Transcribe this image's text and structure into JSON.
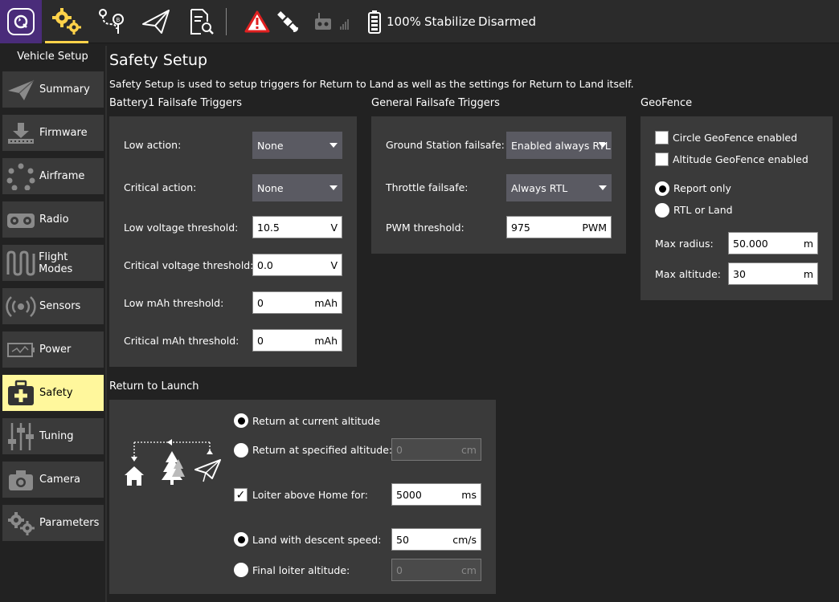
{
  "toolbar": {
    "battery_pct": "100%",
    "flight_mode": "Stabilize",
    "arm_state": "Disarmed"
  },
  "sidebar": {
    "title": "Vehicle Setup",
    "items": [
      {
        "label": "Summary",
        "icon": "paper-plane-icon"
      },
      {
        "label": "Firmware",
        "icon": "download-icon"
      },
      {
        "label": "Airframe",
        "icon": "airframe-icon"
      },
      {
        "label": "Radio",
        "icon": "radio-icon"
      },
      {
        "label": "Flight Modes",
        "icon": "waves-icon"
      },
      {
        "label": "Sensors",
        "icon": "sensors-icon"
      },
      {
        "label": "Power",
        "icon": "power-icon"
      },
      {
        "label": "Safety",
        "icon": "first-aid-icon"
      },
      {
        "label": "Tuning",
        "icon": "sliders-icon"
      },
      {
        "label": "Camera",
        "icon": "camera-icon"
      },
      {
        "label": "Parameters",
        "icon": "gears-icon"
      }
    ]
  },
  "page": {
    "title": "Safety Setup",
    "description": "Safety Setup is used to setup triggers for Return to Land as well as the settings for Return to Land itself."
  },
  "battery": {
    "title": "Battery1 Failsafe Triggers",
    "low_action_label": "Low action:",
    "low_action_value": "None",
    "critical_action_label": "Critical action:",
    "critical_action_value": "None",
    "low_voltage_label": "Low voltage threshold:",
    "low_voltage_value": "10.5",
    "low_voltage_unit": "V",
    "critical_voltage_label": "Critical voltage threshold:",
    "critical_voltage_value": "0.0",
    "critical_voltage_unit": "V",
    "low_mah_label": "Low mAh threshold:",
    "low_mah_value": "0",
    "low_mah_unit": "mAh",
    "critical_mah_label": "Critical mAh threshold:",
    "critical_mah_value": "0",
    "critical_mah_unit": "mAh"
  },
  "general": {
    "title": "General Failsafe Triggers",
    "gcs_label": "Ground Station failsafe:",
    "gcs_value": "Enabled always RTL",
    "throttle_label": "Throttle failsafe:",
    "throttle_value": "Always RTL",
    "pwm_label": "PWM threshold:",
    "pwm_value": "975",
    "pwm_unit": "PWM"
  },
  "geofence": {
    "title": "GeoFence",
    "circle_label": "Circle GeoFence enabled",
    "circle_checked": false,
    "altitude_label": "Altitude GeoFence enabled",
    "altitude_checked": false,
    "report_only_label": "Report only",
    "rtl_or_land_label": "RTL or Land",
    "selected_action": "Report only",
    "max_radius_label": "Max radius:",
    "max_radius_value": "50.000",
    "max_radius_unit": "m",
    "max_alt_label": "Max altitude:",
    "max_alt_value": "30",
    "max_alt_unit": "m"
  },
  "rtl": {
    "title": "Return to Launch",
    "current_alt_label": "Return at current altitude",
    "specified_alt_label": "Return at specified altitude:",
    "specified_alt_value": "0",
    "specified_alt_unit": "cm",
    "selected_return": "Return at current altitude",
    "loiter_label": "Loiter above Home for:",
    "loiter_checked": true,
    "loiter_value": "5000",
    "loiter_unit": "ms",
    "land_descent_label": "Land with descent speed:",
    "land_descent_value": "50",
    "land_descent_unit": "cm/s",
    "final_loiter_label": "Final loiter altitude:",
    "final_loiter_value": "0",
    "final_loiter_unit": "cm",
    "selected_landing": "Land with descent speed:"
  },
  "colors": {
    "active_tab_underline": "#ffd24a",
    "active_sidebar": "#fff79c",
    "logo_bg": "#4a2c7a",
    "warning_red": "#e02020"
  }
}
